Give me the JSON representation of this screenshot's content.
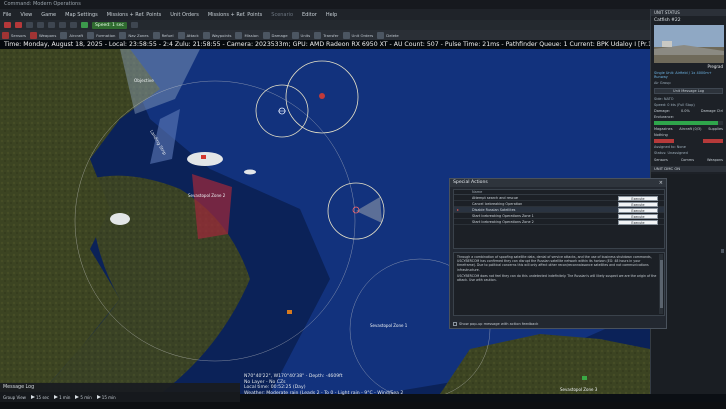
{
  "window": {
    "title": "Command: Modern Operations"
  },
  "menu": {
    "items": [
      "File",
      "View",
      "Game",
      "Map Settings",
      "Missions + Ref. Points",
      "Unit Orders",
      "Missions + Ref. Points",
      "Scenario",
      "Editor",
      "Help"
    ]
  },
  "toolbar": {
    "time_compression": "Speed: 1 sec"
  },
  "commands": [
    "Sensors",
    "Weapons",
    "Aircraft",
    "Formation",
    "Nav Zones",
    "Refuel",
    "Attack",
    "Waypoints",
    "Mission",
    "Damage",
    "Units",
    "Transfer",
    "Unit Orders",
    "Delete"
  ],
  "status": {
    "line": "Time: Monday, August 18, 2025 - Local: 23:58:55 - 2:4 Zulu: 21:58:55 - Camera: 2023533m; GPU: AMD Radeon RX 6950 XT - AU Count: 507 - Pulse Time: 21ms - Pathfinder Queue: 1 Current: BPK Udaloy I [Pr.1155 Fregat]"
  },
  "map": {
    "labels": {
      "objective": "Objective",
      "land_strip": "Landing Strip",
      "zone_two": "Sevastopol Zone 2",
      "zone_one": "Sevastopol Zone 1",
      "zone_three": "Sevastopol Zone 3"
    },
    "cursor": {
      "coords": "N70°40'22\", W170°40'38\" - Depth: -4609ft",
      "layer": "No Layer - No CZs",
      "time": "Local time: 00:52:25 (Day)",
      "weather": "Weather: Moderate rain (Leads 2 - To 0 - Light rain - 9°C - Wind/Sea 2"
    }
  },
  "unit_panel": {
    "header": "UNIT STATUS",
    "name": "Catfish #22",
    "class": "Pregrad",
    "line1": "Single Unit: Airfield / 1x 4000m+ Runway",
    "line2": "Air Group",
    "message_log_btn": "Unit Message Log",
    "side": "Side: NATO",
    "speed": "Speed: 0 kts (Full Stop)",
    "damage_label": "Damage:",
    "damage_value": "0.0%",
    "damage_ctrl": "Damage Ctrl",
    "fuel_label": "Endurance:",
    "fuel_fill": 0.93,
    "magazines": "Magazines",
    "aircraft": "Aircraft (0/3)",
    "supplies": "Supplies",
    "nothing": "Nothing",
    "assigned": "Assigned to: None",
    "status": "Status: Unassigned",
    "tab1": "Sensors",
    "tab2": "Comms",
    "tab3": "Weapons",
    "section": "UNIT DMC ON"
  },
  "dialog": {
    "title": "Special Actions",
    "column": "Name",
    "rows": [
      {
        "name": "Attempt search and rescue",
        "action": "Execute"
      },
      {
        "name": "Cancel Icebreaking Operation",
        "action": "Execute"
      },
      {
        "name": "Disable Russian Satellites",
        "action": "Execute",
        "selected": true
      },
      {
        "name": "Start Icebreaking Operations Zone 1",
        "action": "Execute"
      },
      {
        "name": "Start Icebreaking Operations Zone 2",
        "action": "Execute"
      }
    ],
    "description_p1": "Through a combination of spoofing satellite data, denial of service attacks, and the use of business shutdown commands, USCYBERCOM has confirmed they can disrupt the Russian satellite network within its horizon (EG: 48 hours in your timeframe). Due to political concerns this will only affect other recon/reconnaissance satellites and not communications infrastructure.",
    "description_p2": "USCYBERCOM does not feel they can do this undetected indefinitely. The Russian's will likely suspect we are the origin of the attack. Use with caution.",
    "footer": "Show pop-up message with action feedback"
  },
  "bottom": {
    "message_log": "Message Log",
    "group_view": "Group View",
    "speeds": [
      "15 sec",
      "1 min",
      "5 min",
      "15 min"
    ]
  },
  "colors": {
    "land": "#3a4320",
    "sea": "#1a3b8a",
    "ice": "#e6e8ea",
    "accent": "#2fa54b",
    "danger": "#b63a3a"
  }
}
